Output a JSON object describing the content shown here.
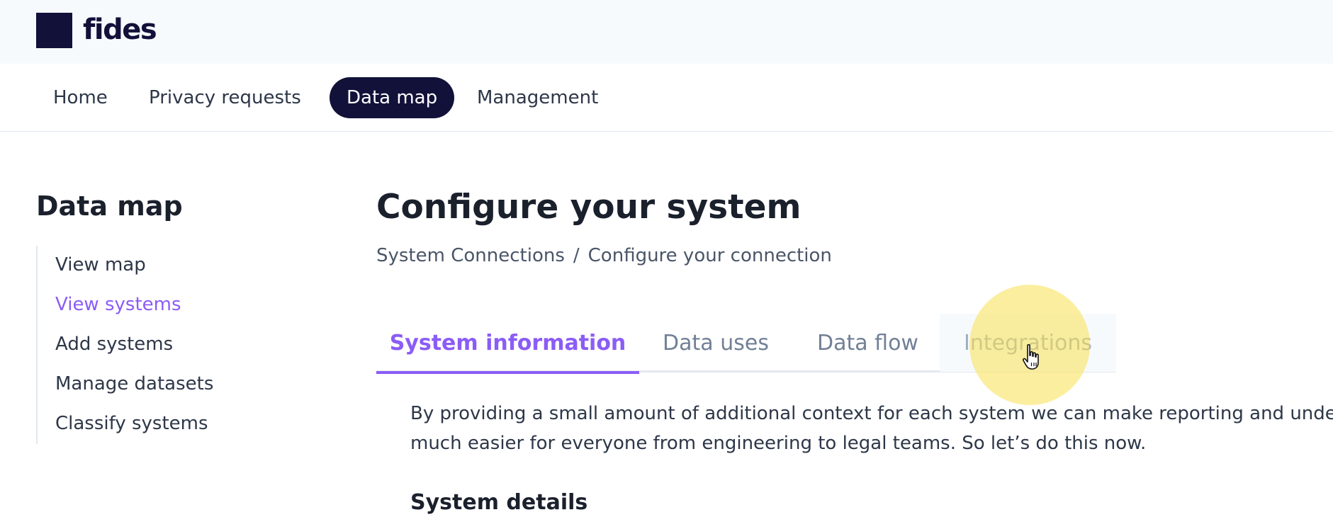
{
  "header": {
    "brand": "fides"
  },
  "nav": {
    "items": [
      {
        "label": "Home"
      },
      {
        "label": "Privacy requests"
      },
      {
        "label": "Data map"
      },
      {
        "label": "Management"
      }
    ],
    "active": "Data map"
  },
  "sidebar": {
    "title": "Data map",
    "items": [
      {
        "label": "View map"
      },
      {
        "label": "View systems"
      },
      {
        "label": "Add systems"
      },
      {
        "label": "Manage datasets"
      },
      {
        "label": "Classify systems"
      }
    ],
    "active": "View systems"
  },
  "main": {
    "title": "Configure your system",
    "breadcrumb": {
      "items": [
        "System Connections",
        "Configure your connection"
      ],
      "separator": "/"
    },
    "tabs": [
      {
        "label": "System information"
      },
      {
        "label": "Data uses"
      },
      {
        "label": "Data flow"
      },
      {
        "label": "Integrations"
      }
    ],
    "active_tab": "System information",
    "intro_lines": [
      "By providing a small amount of additional context for each system we can make reporting and unde",
      "much easier for everyone from engineering to legal teams. So let’s do this now."
    ],
    "section_title": "System details"
  },
  "colors": {
    "brand": "#11113a",
    "accent": "#8b5cf6",
    "highlight": "#fae050"
  }
}
